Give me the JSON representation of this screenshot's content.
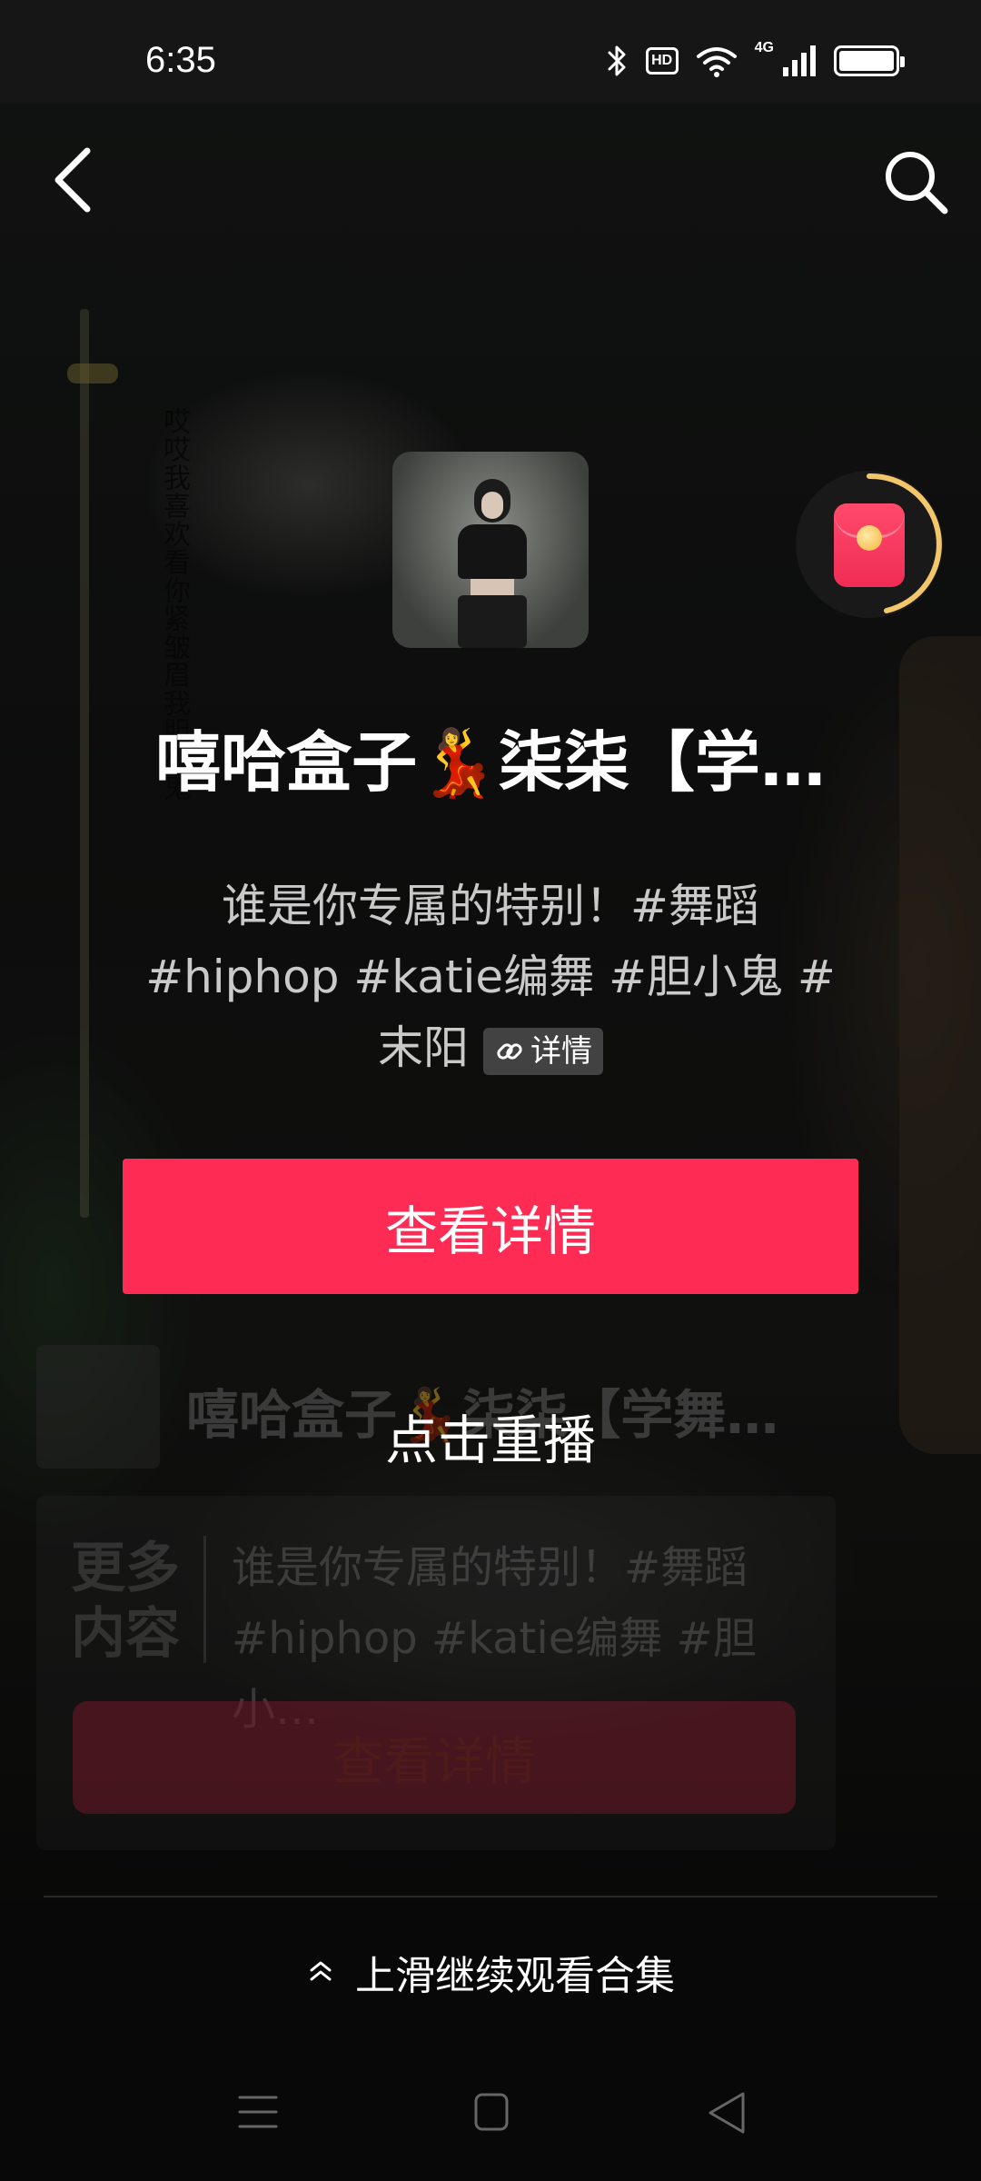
{
  "status_bar": {
    "time": "6:35",
    "hd": "HD",
    "network": "4G"
  },
  "background": {
    "vertical_lyrics": "哎哎我喜欢看你紧皱眉我胆小鬼"
  },
  "card": {
    "title": "嘻哈盒子💃柒柒【学…",
    "description": "谁是你专属的特别！#舞蹈 #hiphop #katie编舞 #胆小鬼 #末阳",
    "detail_chip": "详情",
    "button": "查看详情"
  },
  "replay": "点击重播",
  "ghost_card": {
    "title": "嘻哈盒子💃柒柒【学舞…",
    "more_label": "更多内容",
    "description": "谁是你专属的特别！#舞蹈 #hiphop #katie编舞 #胆小…",
    "button": "查看详情"
  },
  "swipe_hint": "上滑继续观看合集",
  "colors": {
    "accent": "#fe2c55",
    "ring": "#f3c66a"
  },
  "icons": {
    "back": "chevron-left-icon",
    "search": "search-icon",
    "red_packet": "red-packet-icon",
    "link": "link-icon",
    "swipe": "double-chevron-up-icon"
  }
}
